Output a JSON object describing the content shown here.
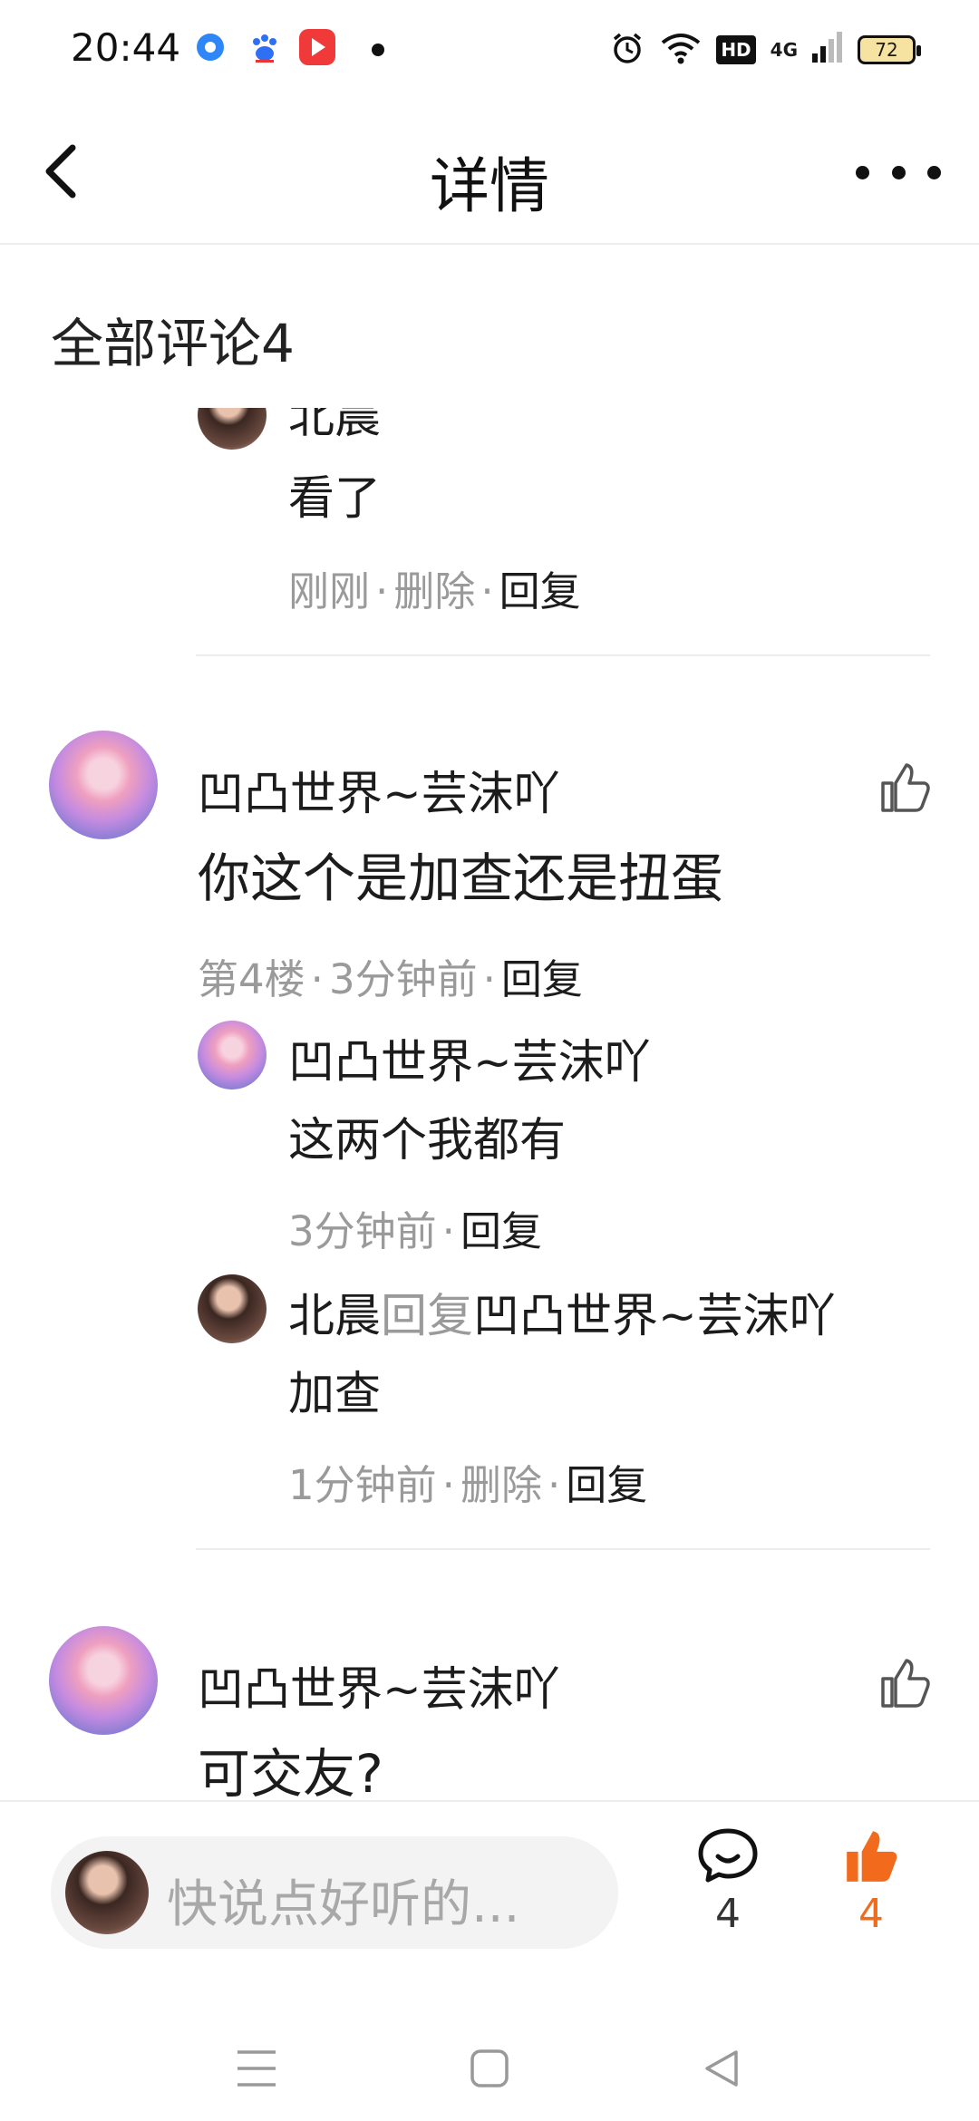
{
  "status_bar": {
    "time": "20:44",
    "hd": "HD",
    "network": "4G",
    "battery": "72",
    "icons": [
      "app-icon-blue",
      "baidu-paw-icon",
      "video-app-icon",
      "notification-dot",
      "alarm-icon",
      "wifi-icon",
      "signal-icon"
    ]
  },
  "nav": {
    "title": "详情",
    "icons": [
      "back-chevron-icon",
      "more-dots-icon"
    ]
  },
  "comments_header": "全部评论4",
  "partial_reply": {
    "author_fragment": "北晨",
    "text": "看了",
    "time": "刚刚",
    "delete": "删除",
    "reply": "回复"
  },
  "comments": [
    {
      "author": "凹凸世界~芸沫吖",
      "text": "你这个是加查还是扭蛋",
      "floor": "第4楼",
      "time": "3分钟前",
      "reply": "回复",
      "replies": [
        {
          "author": "凹凸世界~芸沫吖",
          "text": "这两个我都有",
          "time": "3分钟前",
          "reply": "回复"
        },
        {
          "author": "北晨",
          "reply_word": "回复",
          "target": "凹凸世界~芸沫吖",
          "text": "加查",
          "time": "1分钟前",
          "delete": "删除",
          "reply": "回复"
        }
      ]
    },
    {
      "author": "凹凸世界~芸沫吖",
      "text": "可交友?"
    }
  ],
  "bottom_bar": {
    "placeholder": "快说点好听的...",
    "comment_count": "4",
    "like_count": "4"
  },
  "colors": {
    "accent_orange": "#f26b1d",
    "meta_gray": "#9a9a9a",
    "divider": "#ececec"
  }
}
